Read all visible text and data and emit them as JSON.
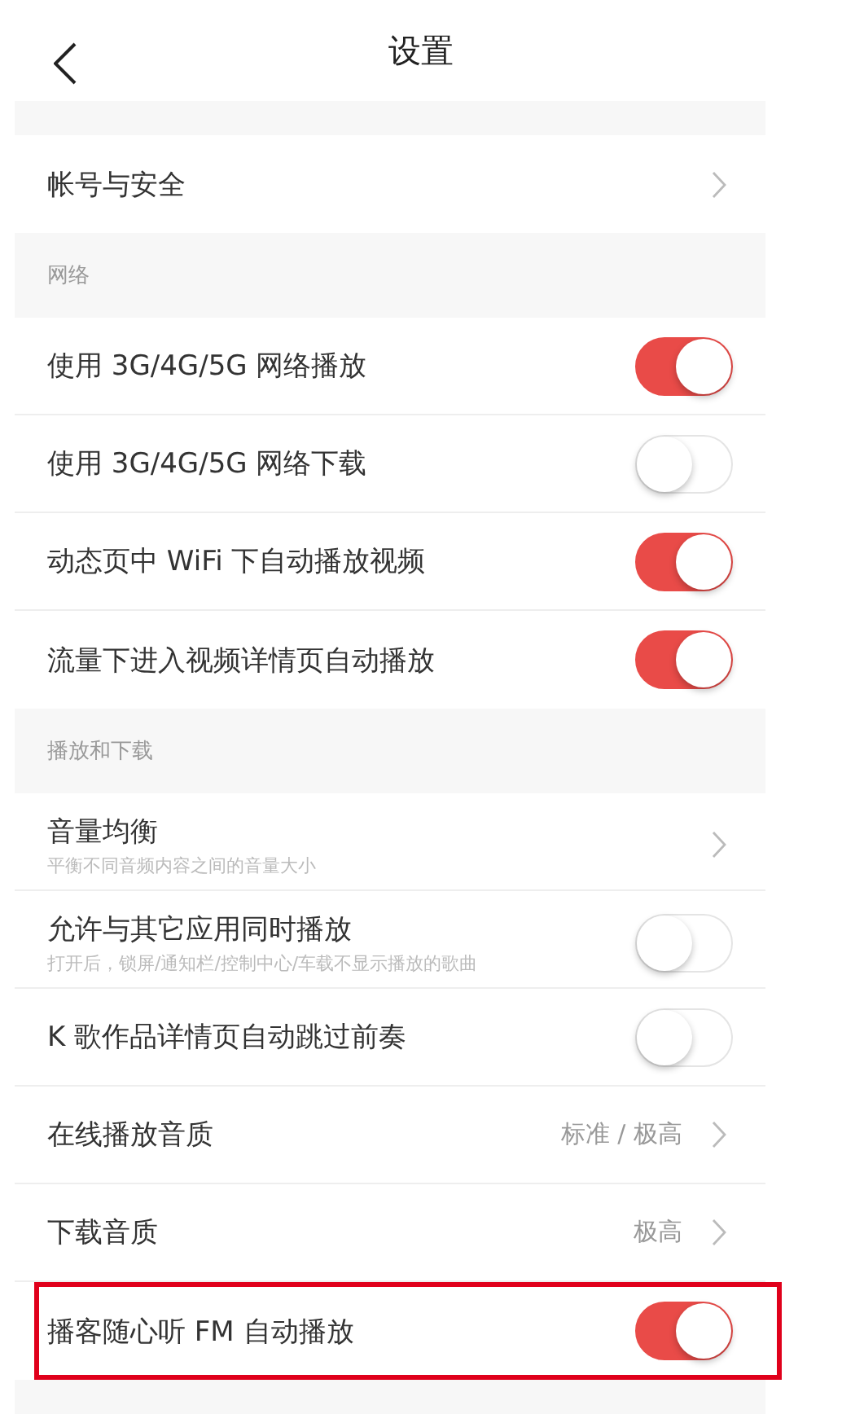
{
  "header": {
    "title": "设置"
  },
  "sections": [
    {
      "rows": [
        {
          "kind": "nav",
          "label": "帐号与安全",
          "highlighted": false
        }
      ]
    },
    {
      "title": "网络",
      "rows": [
        {
          "kind": "toggle",
          "label": "使用 3G/4G/5G 网络播放",
          "on": true,
          "highlighted": false
        },
        {
          "kind": "toggle",
          "label": "使用 3G/4G/5G 网络下载",
          "on": false,
          "highlighted": false
        },
        {
          "kind": "toggle",
          "label": "动态页中 WiFi 下自动播放视频",
          "on": true,
          "highlighted": false
        },
        {
          "kind": "toggle",
          "label": "流量下进入视频详情页自动播放",
          "on": true,
          "highlighted": false
        }
      ]
    },
    {
      "title": "播放和下载",
      "rows": [
        {
          "kind": "nav",
          "label": "音量均衡",
          "subtitle": "平衡不同音频内容之间的音量大小",
          "highlighted": false
        },
        {
          "kind": "toggle",
          "label": "允许与其它应用同时播放",
          "subtitle": "打开后，锁屏/通知栏/控制中心/车载不显示播放的歌曲",
          "on": false,
          "highlighted": false
        },
        {
          "kind": "toggle",
          "label": "K 歌作品详情页自动跳过前奏",
          "on": false,
          "highlighted": false
        },
        {
          "kind": "nav",
          "label": "在线播放音质",
          "value": "标准 / 极高",
          "highlighted": false
        },
        {
          "kind": "nav",
          "label": "下载音质",
          "value": "极高",
          "highlighted": false
        },
        {
          "kind": "toggle",
          "label": "播客随心听 FM 自动播放",
          "on": true,
          "highlighted": true
        }
      ]
    }
  ]
}
